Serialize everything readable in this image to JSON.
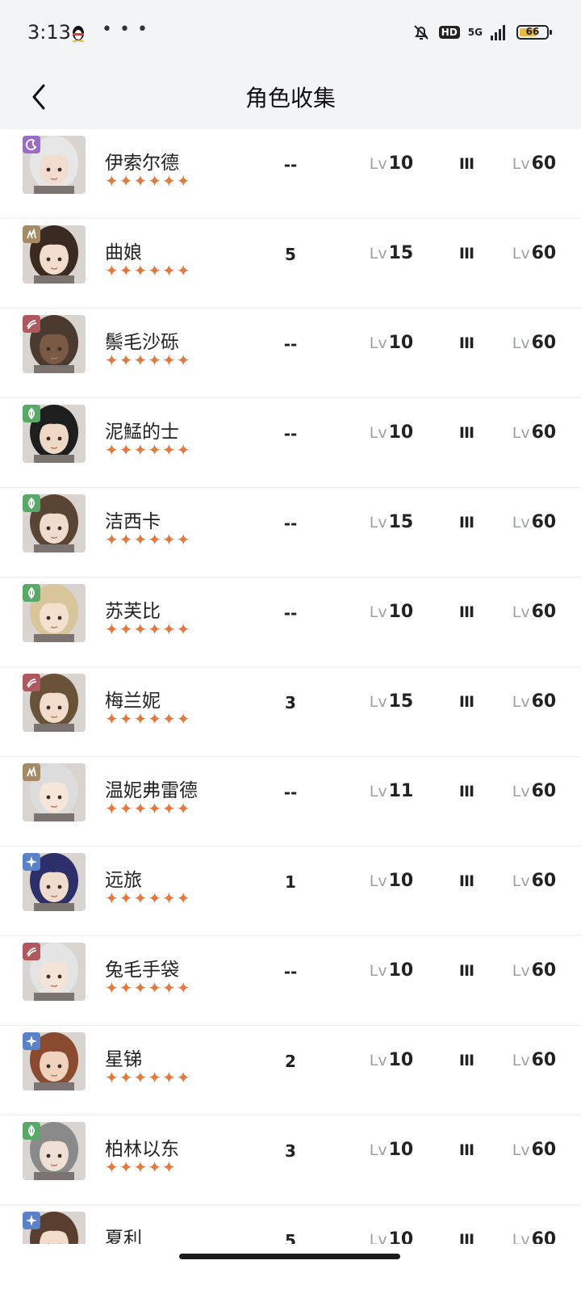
{
  "status_bar": {
    "time": "3:13",
    "network": "5G",
    "hd": "HD",
    "battery": "66"
  },
  "nav": {
    "title": "角色收集"
  },
  "colors": {
    "star": "#e07a3f",
    "badge_purple": "#9b6bc8",
    "badge_tan": "#a58a63",
    "badge_red": "#b0585e",
    "badge_green": "#58a868",
    "badge_blue": "#5a82c8"
  },
  "lv_prefix": "Lv",
  "characters": [
    {
      "name": "伊索尔德",
      "stars": "✦✦✦✦✦✦",
      "col1": "--",
      "level": "10",
      "rank": "III",
      "max_level": "60",
      "badge": "moon-icon",
      "badge_color": "#9b6bc8",
      "hair": "#e6e6e6",
      "skin": "#f1ddd0"
    },
    {
      "name": "曲娘",
      "stars": "✦✦✦✦✦✦",
      "col1": "5",
      "level": "15",
      "rank": "III",
      "max_level": "60",
      "badge": "beast-icon",
      "badge_color": "#a58a63",
      "hair": "#3a2a22",
      "skin": "#f2dccb"
    },
    {
      "name": "鬃毛沙砾",
      "stars": "✦✦✦✦✦✦",
      "col1": "--",
      "level": "10",
      "rank": "III",
      "max_level": "60",
      "badge": "wave-icon",
      "badge_color": "#b0585e",
      "hair": "#4a3a30",
      "skin": "#7a5a44"
    },
    {
      "name": "泥鯭的士",
      "stars": "✦✦✦✦✦✦",
      "col1": "--",
      "level": "10",
      "rank": "III",
      "max_level": "60",
      "badge": "leaf-icon",
      "badge_color": "#58a868",
      "hair": "#1e1e1e",
      "skin": "#efd8c6"
    },
    {
      "name": "洁西卡",
      "stars": "✦✦✦✦✦✦",
      "col1": "--",
      "level": "15",
      "rank": "III",
      "max_level": "60",
      "badge": "leaf-icon",
      "badge_color": "#58a868",
      "hair": "#5a4434",
      "skin": "#f0dccd"
    },
    {
      "name": "苏芙比",
      "stars": "✦✦✦✦✦✦",
      "col1": "--",
      "level": "10",
      "rank": "III",
      "max_level": "60",
      "badge": "leaf-icon",
      "badge_color": "#58a868",
      "hair": "#d8c69a",
      "skin": "#f4e0cf"
    },
    {
      "name": "梅兰妮",
      "stars": "✦✦✦✦✦✦",
      "col1": "3",
      "level": "15",
      "rank": "III",
      "max_level": "60",
      "badge": "wave-icon",
      "badge_color": "#b0585e",
      "hair": "#6a5238",
      "skin": "#f2dccb"
    },
    {
      "name": "温妮弗雷德",
      "stars": "✦✦✦✦✦✦",
      "col1": "--",
      "level": "11",
      "rank": "III",
      "max_level": "60",
      "badge": "beast-icon",
      "badge_color": "#a58a63",
      "hair": "#dcdcdc",
      "skin": "#f6e6da"
    },
    {
      "name": "远旅",
      "stars": "✦✦✦✦✦✦",
      "col1": "1",
      "level": "10",
      "rank": "III",
      "max_level": "60",
      "badge": "star-icon",
      "badge_color": "#5a82c8",
      "hair": "#2c2f6a",
      "skin": "#f0dccd"
    },
    {
      "name": "兔毛手袋",
      "stars": "✦✦✦✦✦✦",
      "col1": "--",
      "level": "10",
      "rank": "III",
      "max_level": "60",
      "badge": "wave-icon",
      "badge_color": "#b0585e",
      "hair": "#e4e4e4",
      "skin": "#f4e4d8"
    },
    {
      "name": "星锑",
      "stars": "✦✦✦✦✦✦",
      "col1": "2",
      "level": "10",
      "rank": "III",
      "max_level": "60",
      "badge": "star-icon",
      "badge_color": "#5a82c8",
      "hair": "#8a4a30",
      "skin": "#f0d2bd"
    },
    {
      "name": "柏林以东",
      "stars": "✦✦✦✦✦",
      "col1": "3",
      "level": "10",
      "rank": "III",
      "max_level": "60",
      "badge": "leaf-icon",
      "badge_color": "#58a868",
      "hair": "#8a8a8a",
      "skin": "#efe0d6"
    },
    {
      "name": "夏利",
      "stars": "✦✦✦✦✦✦",
      "col1": "5",
      "level": "10",
      "rank": "III",
      "max_level": "60",
      "badge": "star-icon",
      "badge_color": "#5a82c8",
      "hair": "#5a3e30",
      "skin": "#f2dccb"
    }
  ]
}
